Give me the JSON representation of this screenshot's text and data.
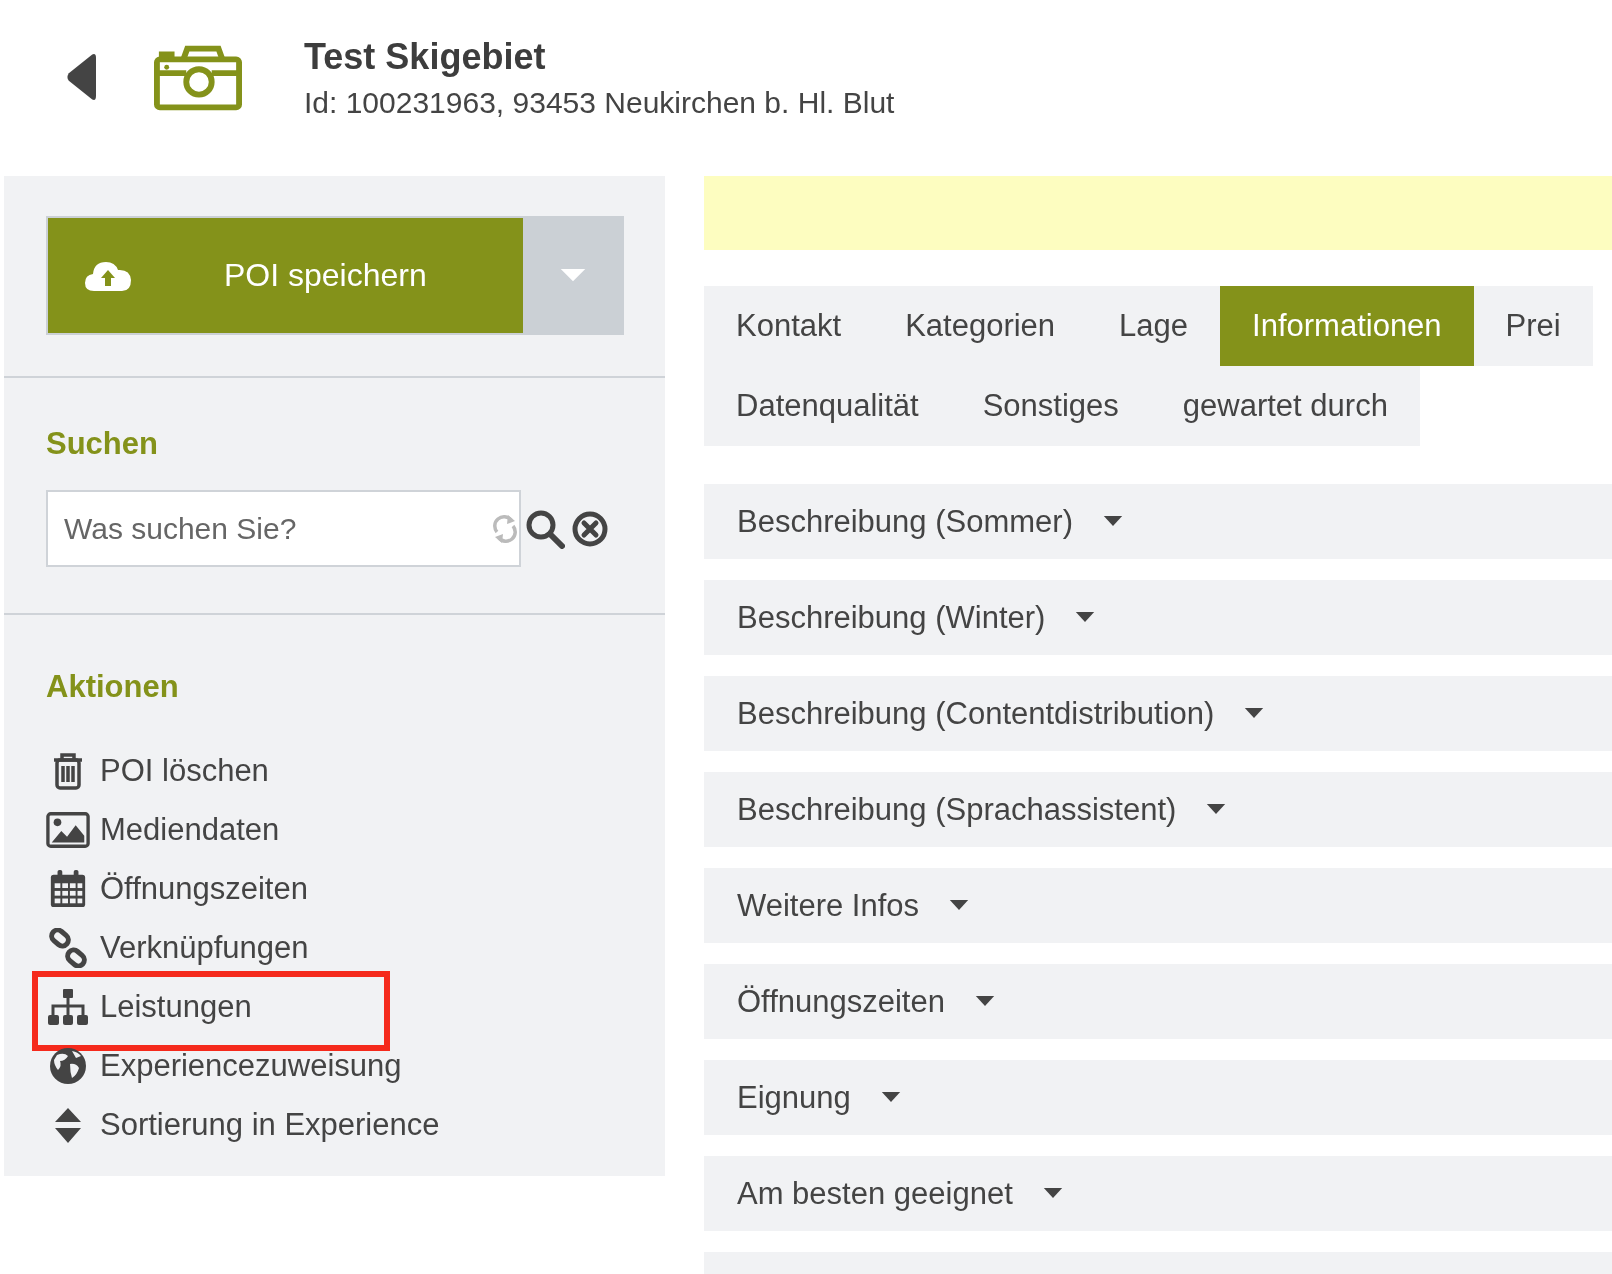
{
  "header": {
    "title": "Test Skigebiet",
    "subtitle": "Id: 100231963, 93453 Neukirchen b. Hl. Blut"
  },
  "sidebar": {
    "save_button": "POI speichern",
    "search": {
      "heading": "Suchen",
      "placeholder": "Was suchen Sie?"
    },
    "actions": {
      "heading": "Aktionen",
      "items": [
        {
          "kind": "trash",
          "label": "POI löschen",
          "highlighted": false
        },
        {
          "kind": "image",
          "label": "Mediendaten",
          "highlighted": false
        },
        {
          "kind": "calendar",
          "label": "Öffnungszeiten",
          "highlighted": false
        },
        {
          "kind": "link",
          "label": "Verknüpfungen",
          "highlighted": false
        },
        {
          "kind": "sitemap",
          "label": "Leistungen",
          "highlighted": true
        },
        {
          "kind": "globe",
          "label": "Experiencezuweisung",
          "highlighted": false
        },
        {
          "kind": "sort",
          "label": "Sortierung in Experience",
          "highlighted": false
        }
      ]
    }
  },
  "tabs": [
    [
      {
        "label": "Kontakt",
        "selected": false
      },
      {
        "label": "Kategorien",
        "selected": false
      },
      {
        "label": "Lage",
        "selected": false
      },
      {
        "label": "Informationen",
        "selected": true
      },
      {
        "label": "Prei",
        "selected": false
      }
    ],
    [
      {
        "label": "Datenqualität",
        "selected": false
      },
      {
        "label": "Sonstiges",
        "selected": false
      },
      {
        "label": "gewartet durch",
        "selected": false
      }
    ]
  ],
  "sections": [
    "Beschreibung (Sommer)",
    "Beschreibung (Winter)",
    "Beschreibung (Contentdistribution)",
    "Beschreibung (Sprachassistent)",
    "Weitere Infos",
    "Öffnungszeiten",
    "Eignung",
    "Am besten geeignet"
  ]
}
